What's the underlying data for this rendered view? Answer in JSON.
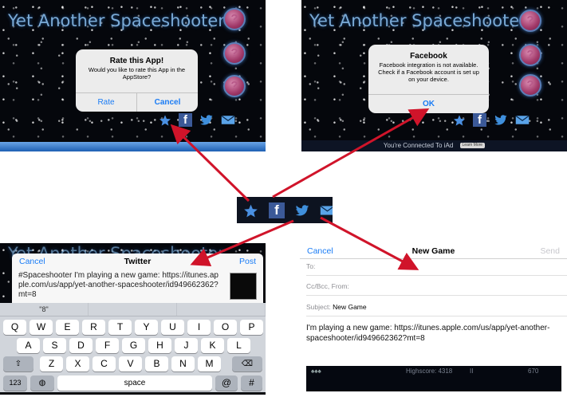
{
  "game": {
    "title": "Yet Another Spaceshooter",
    "circle_glyph": "?"
  },
  "rate_dialog": {
    "title": "Rate this App!",
    "message": "Would you like to rate this App in the AppStore?",
    "rate_label": "Rate",
    "cancel_label": "Cancel"
  },
  "facebook_dialog": {
    "title": "Facebook",
    "message": "Facebook integration is not available. Check if a Facebook account is set up on your device.",
    "ok_label": "OK"
  },
  "iad": {
    "text": "You're Connected To iAd",
    "learn_more": "Learn More"
  },
  "share_icons": [
    "star-icon",
    "facebook-icon",
    "twitter-icon",
    "mail-icon"
  ],
  "twitter": {
    "cancel": "Cancel",
    "title": "Twitter",
    "post": "Post",
    "text": "#Spaceshooter I'm playing a new game: https://itunes.apple.com/us/app/yet-another-spaceshooter/id949662362?mt=8",
    "suggestion": "\"8\""
  },
  "keyboard": {
    "row1": [
      "Q",
      "W",
      "E",
      "R",
      "T",
      "Y",
      "U",
      "I",
      "O",
      "P"
    ],
    "row2": [
      "A",
      "S",
      "D",
      "F",
      "G",
      "H",
      "J",
      "K",
      "L"
    ],
    "row3": [
      "Z",
      "X",
      "C",
      "V",
      "B",
      "N",
      "M"
    ],
    "num_key": "123",
    "space": "space",
    "at": "@",
    "hash": "#"
  },
  "mail": {
    "cancel": "Cancel",
    "title": "New Game",
    "send": "Send",
    "to_label": "To:",
    "cc_label": "Cc/Bcc, From:",
    "subject_label": "Subject:",
    "subject_value": "New Game",
    "body": "I'm playing a new game: https://itunes.apple.com/us/app/yet-another-spaceshooter/id949662362?mt=8",
    "highscore": "Highscore: 4318",
    "score": "670",
    "lives": "♠♠♠",
    "pause": "II"
  },
  "colors": {
    "ios_blue": "#1a7cf5",
    "arrow_red": "#d0142a",
    "facebook_blue": "#3b5998"
  }
}
